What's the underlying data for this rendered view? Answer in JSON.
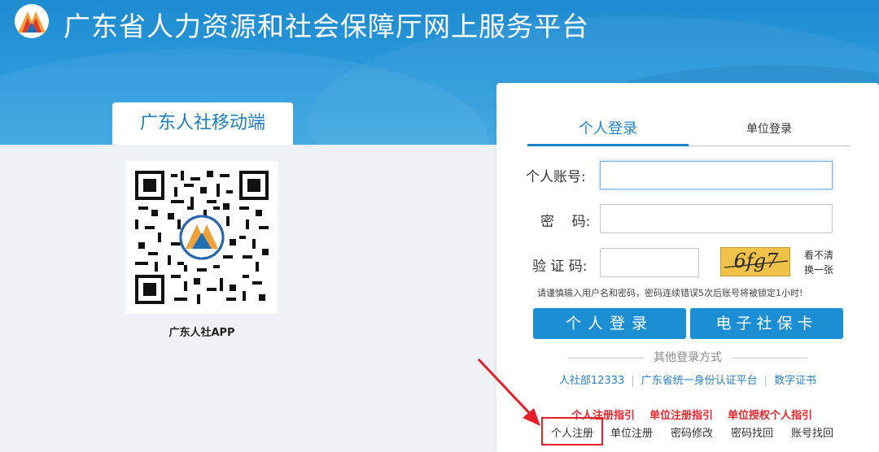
{
  "header": {
    "site_title": "广东省人力资源和社会保障厅网上服务平台",
    "logo_icon": "hrss-mountain-logo-icon"
  },
  "mobile": {
    "tab_label": "广东人社移动端",
    "qr_icon": "qr-code-icon",
    "app_label": "广东人社APP"
  },
  "login": {
    "tabs": [
      {
        "label": "个人登录",
        "active": true
      },
      {
        "label": "单位登录",
        "active": false
      }
    ],
    "fields": {
      "account_label": "个人账号:",
      "account_value": "",
      "password_label": "密    码:",
      "password_value": "",
      "captcha_label": "验 证 码:",
      "captcha_value": ""
    },
    "captcha": {
      "image_text": "6fg7",
      "refresh_line1": "看不清",
      "refresh_line2": "换一张"
    },
    "notice": "请谨慎输入用户名和密码，密码连续错误5次后账号将被锁定1小时!",
    "buttons": {
      "personal_login": "个人登录",
      "social_card": "电子社保卡"
    },
    "other_methods_label": "其他登录方式",
    "alt_links": [
      "人社部12333",
      "广东省统一身份认证平台",
      "数字证书"
    ],
    "guide_links": [
      "个人注册指引",
      "单位注册指引",
      "单位授权个人指引"
    ],
    "bottom_links": [
      "个人注册",
      "单位注册",
      "密码修改",
      "密码找回",
      "账号找回"
    ]
  },
  "colors": {
    "header_blue": "#2c9bdc",
    "button_blue": "#1c8fd4",
    "link_blue": "#2a7fc9",
    "guide_red": "#e8252a",
    "highlight_red": "#e6202a",
    "captcha_yellow": "#f1c24a"
  }
}
